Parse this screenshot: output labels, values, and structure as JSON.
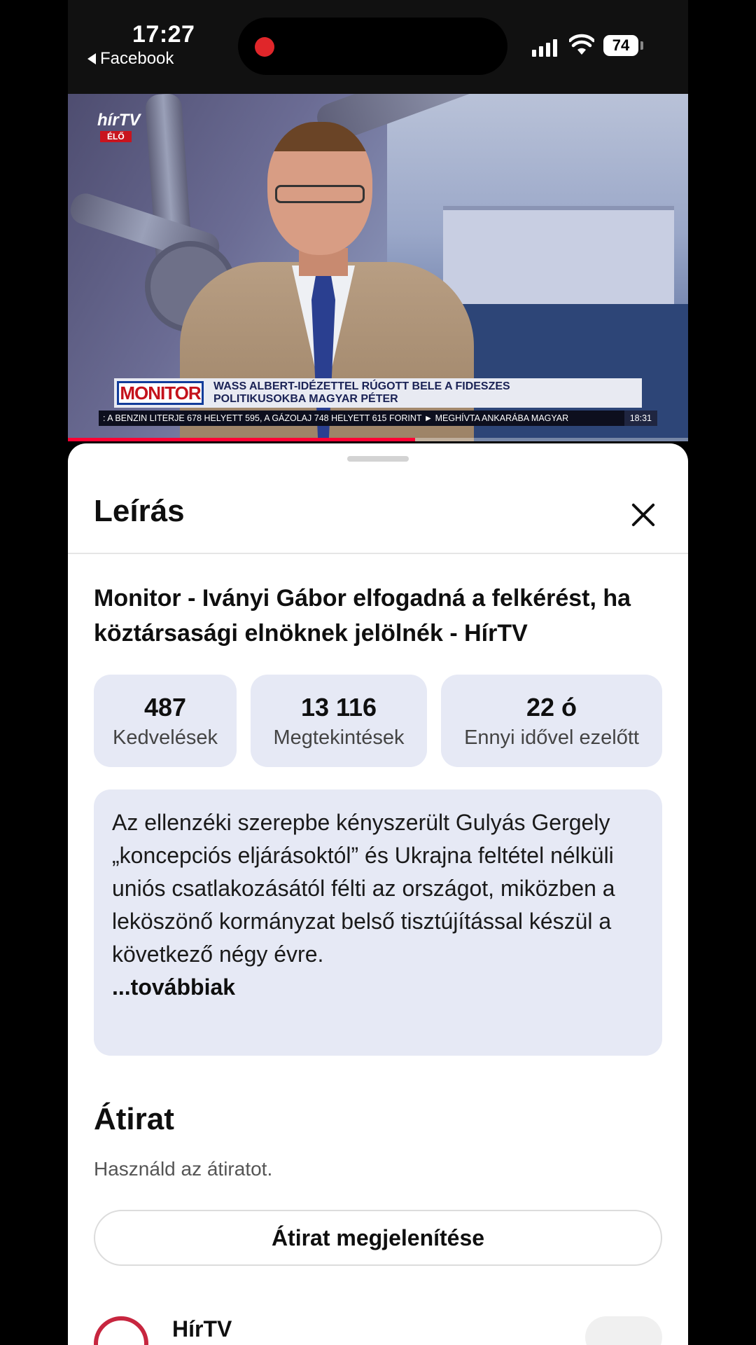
{
  "status_bar": {
    "time": "17:27",
    "back_app": "Facebook",
    "battery": "74"
  },
  "video": {
    "channel_logo": "hírTV",
    "channel_live": "ÉLŐ",
    "show_logo": "MONITOR",
    "headline_line1": "WASS ALBERT-IDÉZETTEL RÚGOTT BELE A FIDESZES",
    "headline_line2": "POLITIKUSOKBA MAGYAR PÉTER",
    "ticker_text": ": A BENZIN LITERJE 678 HELYETT 595, A GÁZOLAJ 748 HELYETT 615 FORINT  ►  MEGHÍVTA ANKARÁBA MAGYAR",
    "ticker_clock": "18:31",
    "progress_fraction": 0.56,
    "accent_color": "#ff0033"
  },
  "sheet": {
    "title": "Leírás",
    "close_icon": "close-icon",
    "video_title": "Monitor - Iványi Gábor elfogadná a felkérést, ha köztársasági elnöknek jelölnék - HírTV",
    "stats": [
      {
        "value": "487",
        "label": "Kedvelések"
      },
      {
        "value": "13 116",
        "label": "Megtekintések"
      },
      {
        "value": "22 ó",
        "label": "Ennyi idővel ezelőtt"
      }
    ],
    "description": "Az ellenzéki szerepbe kényszerült Gulyás Gergely „koncepciós eljárásoktól” és Ukrajna feltétel nélküli uniós csatlakozásától félti az országot, miközben a leköszönő kormányzat belső tisztújítással készül a következő négy évre.",
    "more_label": "...továbbiak",
    "transcript": {
      "title": "Átirat",
      "subtitle": "Használd az átiratot.",
      "button_label": "Átirat megjelenítése"
    },
    "channel_name": "HírTV"
  }
}
